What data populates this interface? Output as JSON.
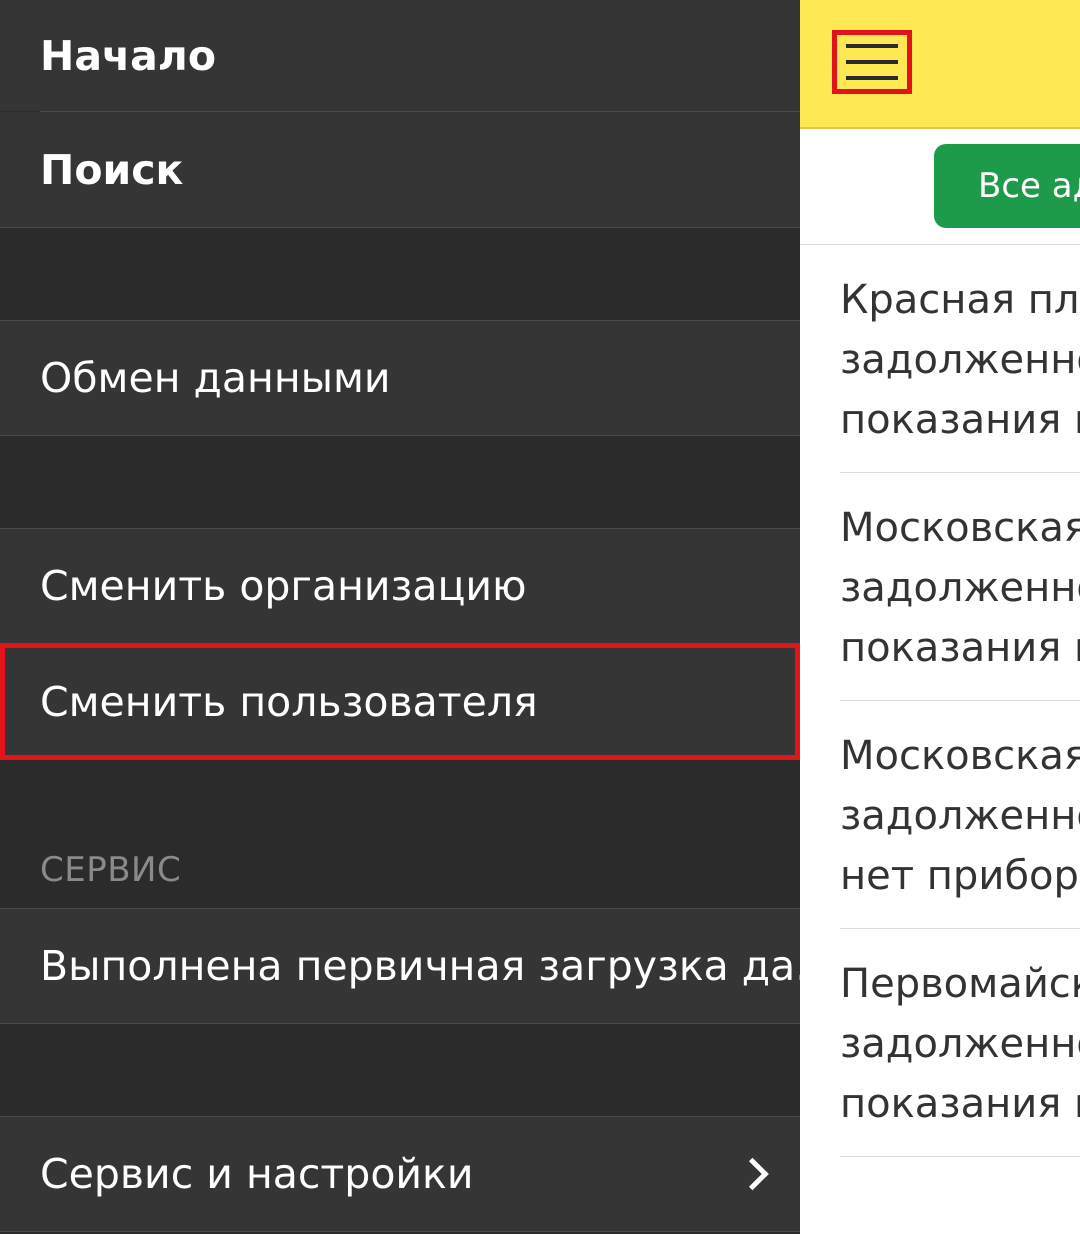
{
  "drawer": {
    "items": {
      "home": "Начало",
      "search": "Поиск",
      "exchange": "Обмен данными",
      "change_org": "Сменить организацию",
      "change_user": "Сменить пользователя",
      "initial_load": "Выполнена первичная загрузка да...",
      "service_settings": "Сервис и настройки"
    },
    "section_service": "СЕРВИС"
  },
  "header": {
    "menu_icon": "hamburger-menu-icon",
    "accent": "#fde854"
  },
  "filter": {
    "button_label": "Все ад",
    "button_color": "#1d9b4a"
  },
  "list": [
    {
      "line1": "Красная пло",
      "line2": "задолженно",
      "line3": "показания п"
    },
    {
      "line1": "Московская",
      "line2": "задолженно",
      "line3": "показания п"
    },
    {
      "line1": "Московская",
      "line2": "задолженно",
      "line3": "нет приборо"
    },
    {
      "line1": "Первомайск",
      "line2": "задолженно",
      "line3": "показания п"
    }
  ],
  "highlight_color": "#e3131b"
}
